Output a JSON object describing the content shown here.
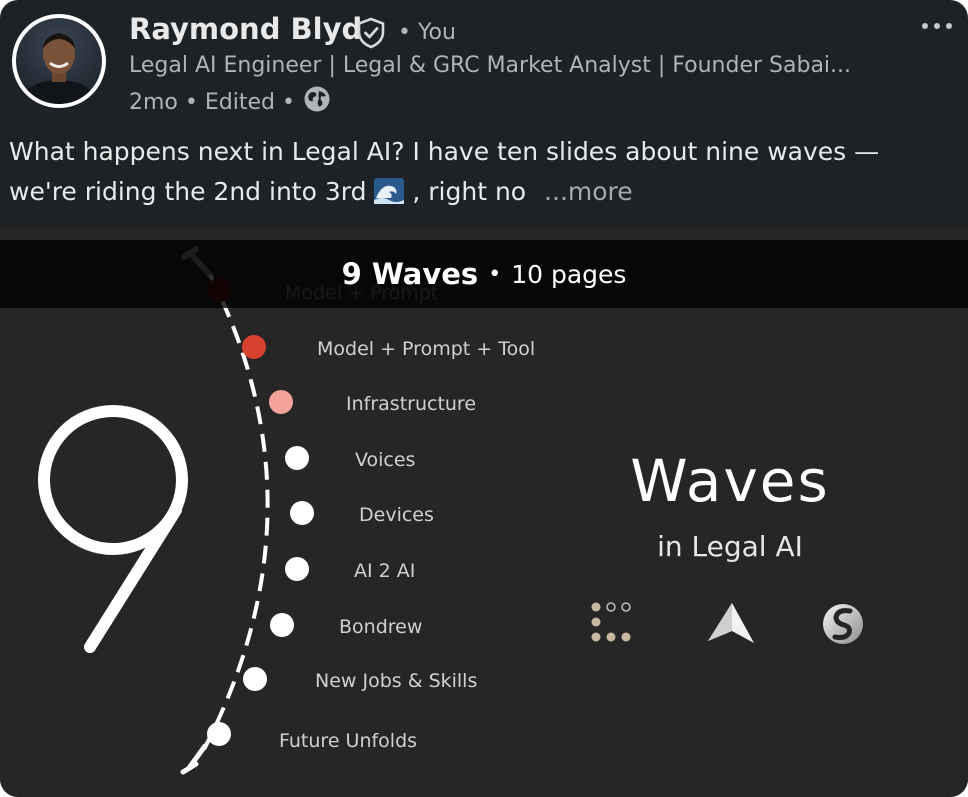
{
  "post": {
    "author": "Raymond Blyd",
    "relation": "• You",
    "headline": "Legal AI Engineer | Legal & GRC Market Analyst | Founder Sabai...",
    "time": "2mo",
    "edited": "Edited",
    "sep": "•",
    "text_line1": "What happens next in Legal AI? I have ten slides about nine waves —",
    "text_line2_a": "we're riding the 2nd into 3rd",
    "text_line2_b": ", right no",
    "see_more": "...more"
  },
  "document": {
    "title": "9 Waves",
    "title_sep": "•",
    "pages": "10 pages",
    "big_number": "9",
    "heading": "Waves",
    "subheading": "in Legal AI",
    "waves": [
      {
        "label": "Model + Prompt",
        "color": "#5a1818"
      },
      {
        "label": "Model + Prompt + Tool",
        "color": "#d9412f"
      },
      {
        "label": "Infrastructure",
        "color": "#f3a39a"
      },
      {
        "label": "Voices",
        "color": "#ffffff"
      },
      {
        "label": "Devices",
        "color": "#ffffff"
      },
      {
        "label": "AI 2 AI",
        "color": "#ffffff"
      },
      {
        "label": "Bondrew",
        "color": "#ffffff"
      },
      {
        "label": "New Jobs & Skills",
        "color": "#ffffff"
      },
      {
        "label": "Future Unfolds",
        "color": "#ffffff"
      }
    ]
  },
  "icons": {
    "verified": "verified-shield-icon",
    "globe": "globe-icon",
    "more": "more-horizontal-icon",
    "wave_emoji": "wave-emoji-icon"
  },
  "colors": {
    "card_bg": "#1d2226",
    "slide_bg": "#262626",
    "accent_red": "#d9412f"
  }
}
